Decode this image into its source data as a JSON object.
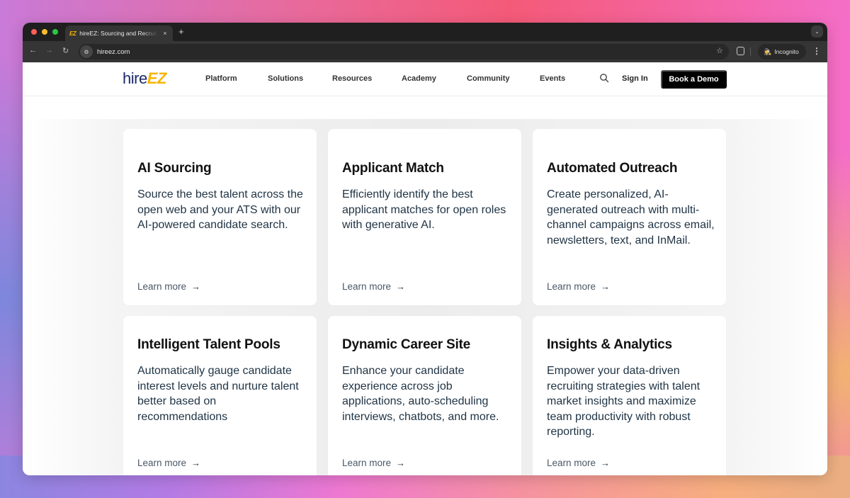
{
  "browser": {
    "tab": {
      "favicon": "EZ",
      "title": "hireEZ: Sourcing and Recruiting",
      "close_icon": "×"
    },
    "new_tab_icon": "+",
    "tab_menu_icon": "⌄",
    "nav": {
      "back_icon": "←",
      "forward_icon": "→",
      "reload_icon": "↻"
    },
    "site_info_icon": "⚙",
    "url": "hireez.com",
    "bookmark_icon": "☆",
    "profile": {
      "icon": "🕵",
      "label": "Incognito"
    },
    "menu_icon": "⋮"
  },
  "site": {
    "logo": {
      "part1": "hire",
      "part2": "EZ"
    },
    "nav": [
      "Platform",
      "Solutions",
      "Resources",
      "Academy",
      "Community",
      "Events"
    ],
    "sign_in": "Sign In",
    "cta": "Book a Demo",
    "colors": {
      "brand_navy": "#1d2a6b",
      "brand_yellow": "#f7b500",
      "cta_bg": "#000000"
    }
  },
  "cards": [
    {
      "title": "AI Sourcing",
      "description": "Source the best talent across the open web and your ATS with our AI-powered candidate search.",
      "link": "Learn more",
      "arrow": "→"
    },
    {
      "title": "Applicant Match",
      "description": "Efficiently identify the best applicant matches for open roles with generative AI.",
      "link": "Learn more",
      "arrow": "→"
    },
    {
      "title": "Automated Outreach",
      "description": "Create personalized, AI-generated outreach with multi-channel campaigns across email, newsletters, text, and InMail.",
      "link": "Learn more",
      "arrow": "→"
    },
    {
      "title": "Intelligent Talent Pools",
      "description": "Automatically gauge candidate interest levels and nurture talent better based on recommendations",
      "link": "Learn more",
      "arrow": "→"
    },
    {
      "title": "Dynamic Career Site",
      "description": "Enhance your candidate experience across job applications, auto-scheduling interviews, chatbots, and more.",
      "link": "Learn more",
      "arrow": "→"
    },
    {
      "title": "Insights & Analytics",
      "description": "Empower your data-driven recruiting strategies with talent market insights and maximize team productivity with robust reporting.",
      "link": "Learn more",
      "arrow": "→"
    }
  ]
}
